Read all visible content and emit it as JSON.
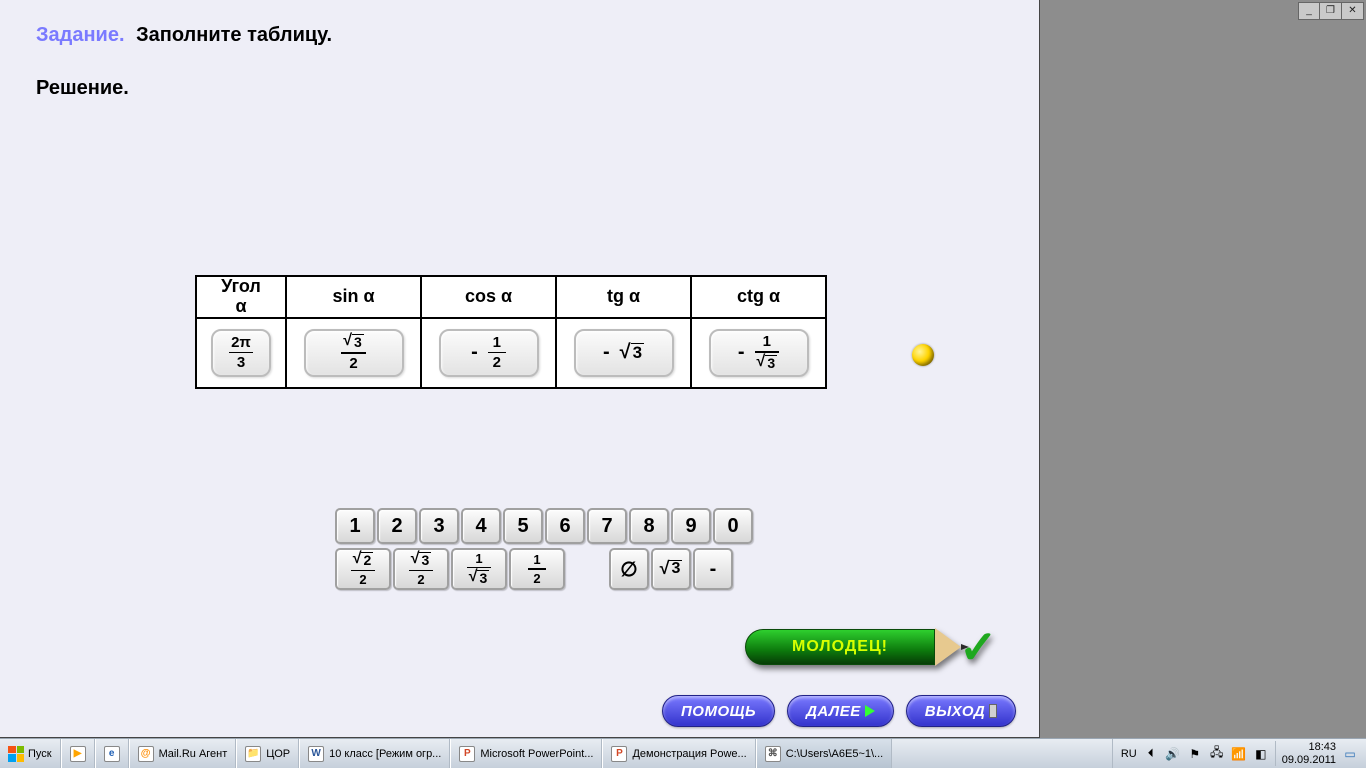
{
  "task": {
    "label": "Задание.",
    "text": "Заполните таблицу."
  },
  "solution_label": "Решение.",
  "table": {
    "headers": [
      "Угол\nα",
      "sin α",
      "cos α",
      "tg α",
      "ctg α"
    ],
    "row": {
      "angle": {
        "num": "2π",
        "den": "3"
      },
      "sin": {
        "sign": "",
        "type": "frac",
        "num_sqrt": "3",
        "den": "2"
      },
      "cos": {
        "sign": "-",
        "type": "frac",
        "num": "1",
        "den": "2"
      },
      "tg": {
        "sign": "-",
        "type": "sqrt",
        "arg": "3"
      },
      "ctg": {
        "sign": "-",
        "type": "frac",
        "num": "1",
        "den_sqrt": "3"
      }
    }
  },
  "keypad": {
    "digits": [
      "1",
      "2",
      "3",
      "4",
      "5",
      "6",
      "7",
      "8",
      "9",
      "0"
    ],
    "row2": [
      {
        "type": "frac",
        "num_sqrt": "2",
        "den": "2"
      },
      {
        "type": "frac",
        "num_sqrt": "3",
        "den": "2"
      },
      {
        "type": "frac",
        "num": "1",
        "den_sqrt": "3"
      },
      {
        "type": "frac",
        "num": "1",
        "den": "2"
      },
      {
        "type": "spacer"
      },
      {
        "type": "text",
        "label": "∅"
      },
      {
        "type": "sqrt",
        "arg": "3"
      },
      {
        "type": "text",
        "label": "-"
      }
    ]
  },
  "pencil_text": "МОЛОДЕЦ!",
  "buttons": {
    "help": "ПОМОЩЬ",
    "next": "ДАЛЕЕ",
    "exit": "ВЫХОД"
  },
  "win_controls": {
    "min": "_",
    "max": "❐",
    "close": "✕"
  },
  "taskbar": {
    "start": "Пуск",
    "items": [
      {
        "icon": "play",
        "label": ""
      },
      {
        "icon": "ie",
        "label": ""
      },
      {
        "icon": "mail",
        "label": "Mail.Ru Агент"
      },
      {
        "icon": "folder",
        "label": "ЦОР"
      },
      {
        "icon": "word",
        "label": "10 класс [Режим огр..."
      },
      {
        "icon": "ppt",
        "label": "Microsoft PowerPoint..."
      },
      {
        "icon": "ppt",
        "label": "Демонстрация Powe..."
      },
      {
        "icon": "cmd",
        "label": "C:\\Users\\A6E5~1\\...",
        "active": true
      }
    ],
    "lang": "RU",
    "time": "18:43",
    "date": "09.09.2011"
  }
}
